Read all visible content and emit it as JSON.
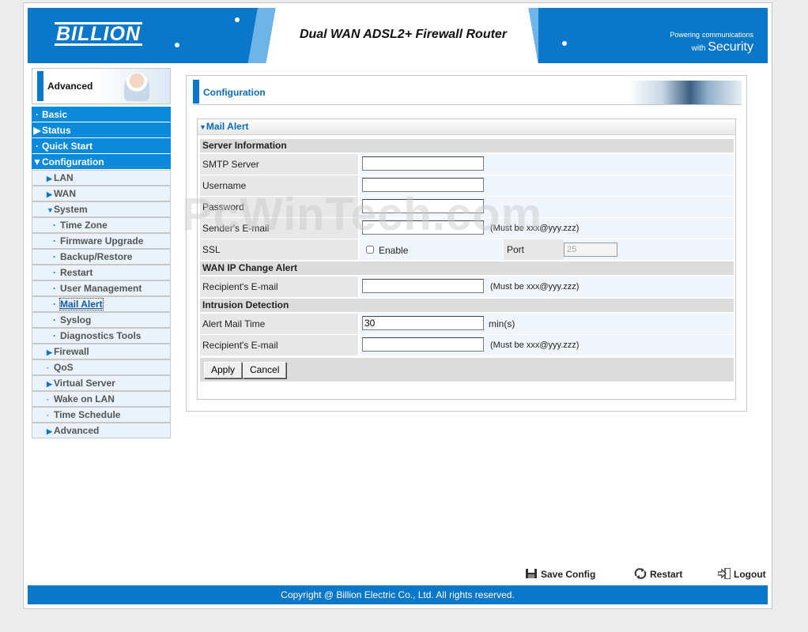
{
  "header": {
    "logo": "BILLION",
    "title": "Dual WAN ADSL2+ Firewall Router",
    "tagline_main": "Powering",
    "tagline_small": "communications",
    "tagline_with": "with",
    "tagline_security": "Security"
  },
  "sidebar": {
    "mode_label": "Advanced",
    "items": [
      {
        "label": "Basic",
        "level": "main",
        "marker": "·"
      },
      {
        "label": "Status",
        "level": "main",
        "marker": "▶"
      },
      {
        "label": "Quick Start",
        "level": "main",
        "marker": "·"
      },
      {
        "label": "Configuration",
        "level": "main",
        "marker": "▼"
      },
      {
        "label": "LAN",
        "level": "sub",
        "marker": "▶"
      },
      {
        "label": "WAN",
        "level": "sub",
        "marker": "▶"
      },
      {
        "label": "System",
        "level": "sub",
        "marker": "▼"
      },
      {
        "label": "Time Zone",
        "level": "sub2",
        "marker": "·"
      },
      {
        "label": "Firmware Upgrade",
        "level": "sub2",
        "marker": "·"
      },
      {
        "label": "Backup/Restore",
        "level": "sub2",
        "marker": "·"
      },
      {
        "label": "Restart",
        "level": "sub2",
        "marker": "·"
      },
      {
        "label": "User Management",
        "level": "sub2",
        "marker": "·"
      },
      {
        "label": "Mail Alert",
        "level": "sub2",
        "marker": "·"
      },
      {
        "label": "Syslog",
        "level": "sub2",
        "marker": "·"
      },
      {
        "label": "Diagnostics Tools",
        "level": "sub2",
        "marker": "·"
      },
      {
        "label": "Firewall",
        "level": "sub",
        "marker": "▶"
      },
      {
        "label": "QoS",
        "level": "sub",
        "marker": "·"
      },
      {
        "label": "Virtual Server",
        "level": "sub",
        "marker": "▶"
      },
      {
        "label": "Wake on LAN",
        "level": "sub",
        "marker": "·"
      },
      {
        "label": "Time Schedule",
        "level": "sub",
        "marker": "·"
      },
      {
        "label": "Advanced",
        "level": "sub",
        "marker": "▶"
      }
    ],
    "active_item": "Mail Alert"
  },
  "content": {
    "title": "Configuration",
    "panel_title": "Mail Alert",
    "sections": {
      "server_info": "Server Information",
      "wan_ip": "WAN IP Change Alert",
      "intrusion": "Intrusion Detection"
    },
    "fields": {
      "smtp_label": "SMTP Server",
      "smtp_value": "",
      "username_label": "Username",
      "username_value": "",
      "password_label": "Password",
      "password_value": "",
      "sender_label": "Sender's E-mail",
      "sender_value": "",
      "sender_hint": "(Must be xxx@yyy.zzz)",
      "ssl_label": "SSL",
      "ssl_enable_label": "Enable",
      "ssl_checked": false,
      "port_label": "Port",
      "port_value": "25",
      "wan_recipient_label": "Recipient's E-mail",
      "wan_recipient_value": "",
      "wan_recipient_hint": "(Must be xxx@yyy.zzz)",
      "alert_time_label": "Alert Mail Time",
      "alert_time_value": "30",
      "alert_time_unit": "min(s)",
      "intr_recipient_label": "Recipient's E-mail",
      "intr_recipient_value": "",
      "intr_recipient_hint": "(Must be xxx@yyy.zzz)"
    },
    "buttons": {
      "apply": "Apply",
      "cancel": "Cancel"
    }
  },
  "watermark": "PcWinTech.com",
  "actions": {
    "save_config": "Save Config",
    "restart": "Restart",
    "logout": "Logout"
  },
  "footer": {
    "copyright": "Copyright @ Billion Electric Co., Ltd. All rights reserved."
  },
  "colors": {
    "brand_blue": "#0a77c8",
    "nav_blue": "#0a8ad8",
    "title_blue": "#0a6cb8"
  }
}
